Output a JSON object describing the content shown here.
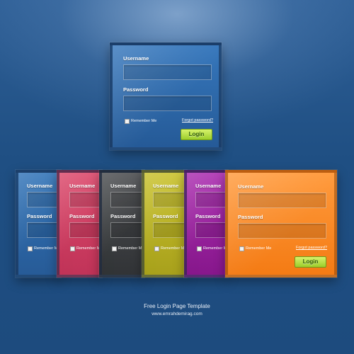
{
  "form": {
    "username_label": "Username",
    "password_label": "Password",
    "remember_label": "Remember Me",
    "forgot_label": "Forgot password?",
    "login_label": "Login"
  },
  "footer": {
    "title": "Free Login Page Template",
    "url": "www.emrahdemirag.com"
  },
  "colors": {
    "background": "#1f4f83",
    "blue": "#2f6fb3",
    "red": "#e2476a",
    "gray": "#4a4a4a",
    "yellow": "#c8bd25",
    "purple": "#a62aa6",
    "orange": "#f98a2a",
    "button": "#b6e04b"
  }
}
